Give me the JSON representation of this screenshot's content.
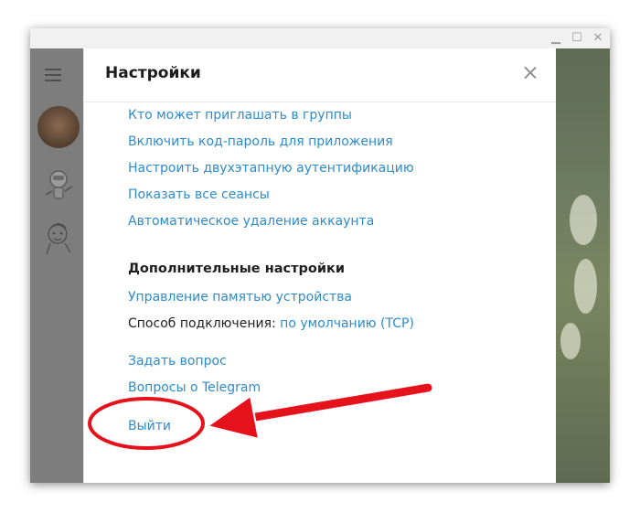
{
  "window_controls": {
    "minimize": "▁",
    "maximize": "☐",
    "close": "✕"
  },
  "settings": {
    "title": "Настройки",
    "privacy_links": [
      "Кто может приглашать в группы",
      "Включить код-пароль для приложения",
      "Настроить двухэтапную аутентификацию",
      "Показать все сеансы",
      "Автоматическое удаление аккаунта"
    ],
    "advanced_title": "Дополнительные настройки",
    "storage_link": "Управление памятью устройства",
    "connection_label": "Способ подключения:",
    "connection_value": "по умолчанию (TCP)",
    "ask_question": "Задать вопрос",
    "faq": "Вопросы о Telegram",
    "logout": "Выйти"
  },
  "colors": {
    "link": "#2e8bcc",
    "annotation": "#e5121b",
    "sidebar": "#7d7d7d"
  },
  "icons": {
    "menu": "hamburger-icon",
    "close": "close-icon"
  }
}
